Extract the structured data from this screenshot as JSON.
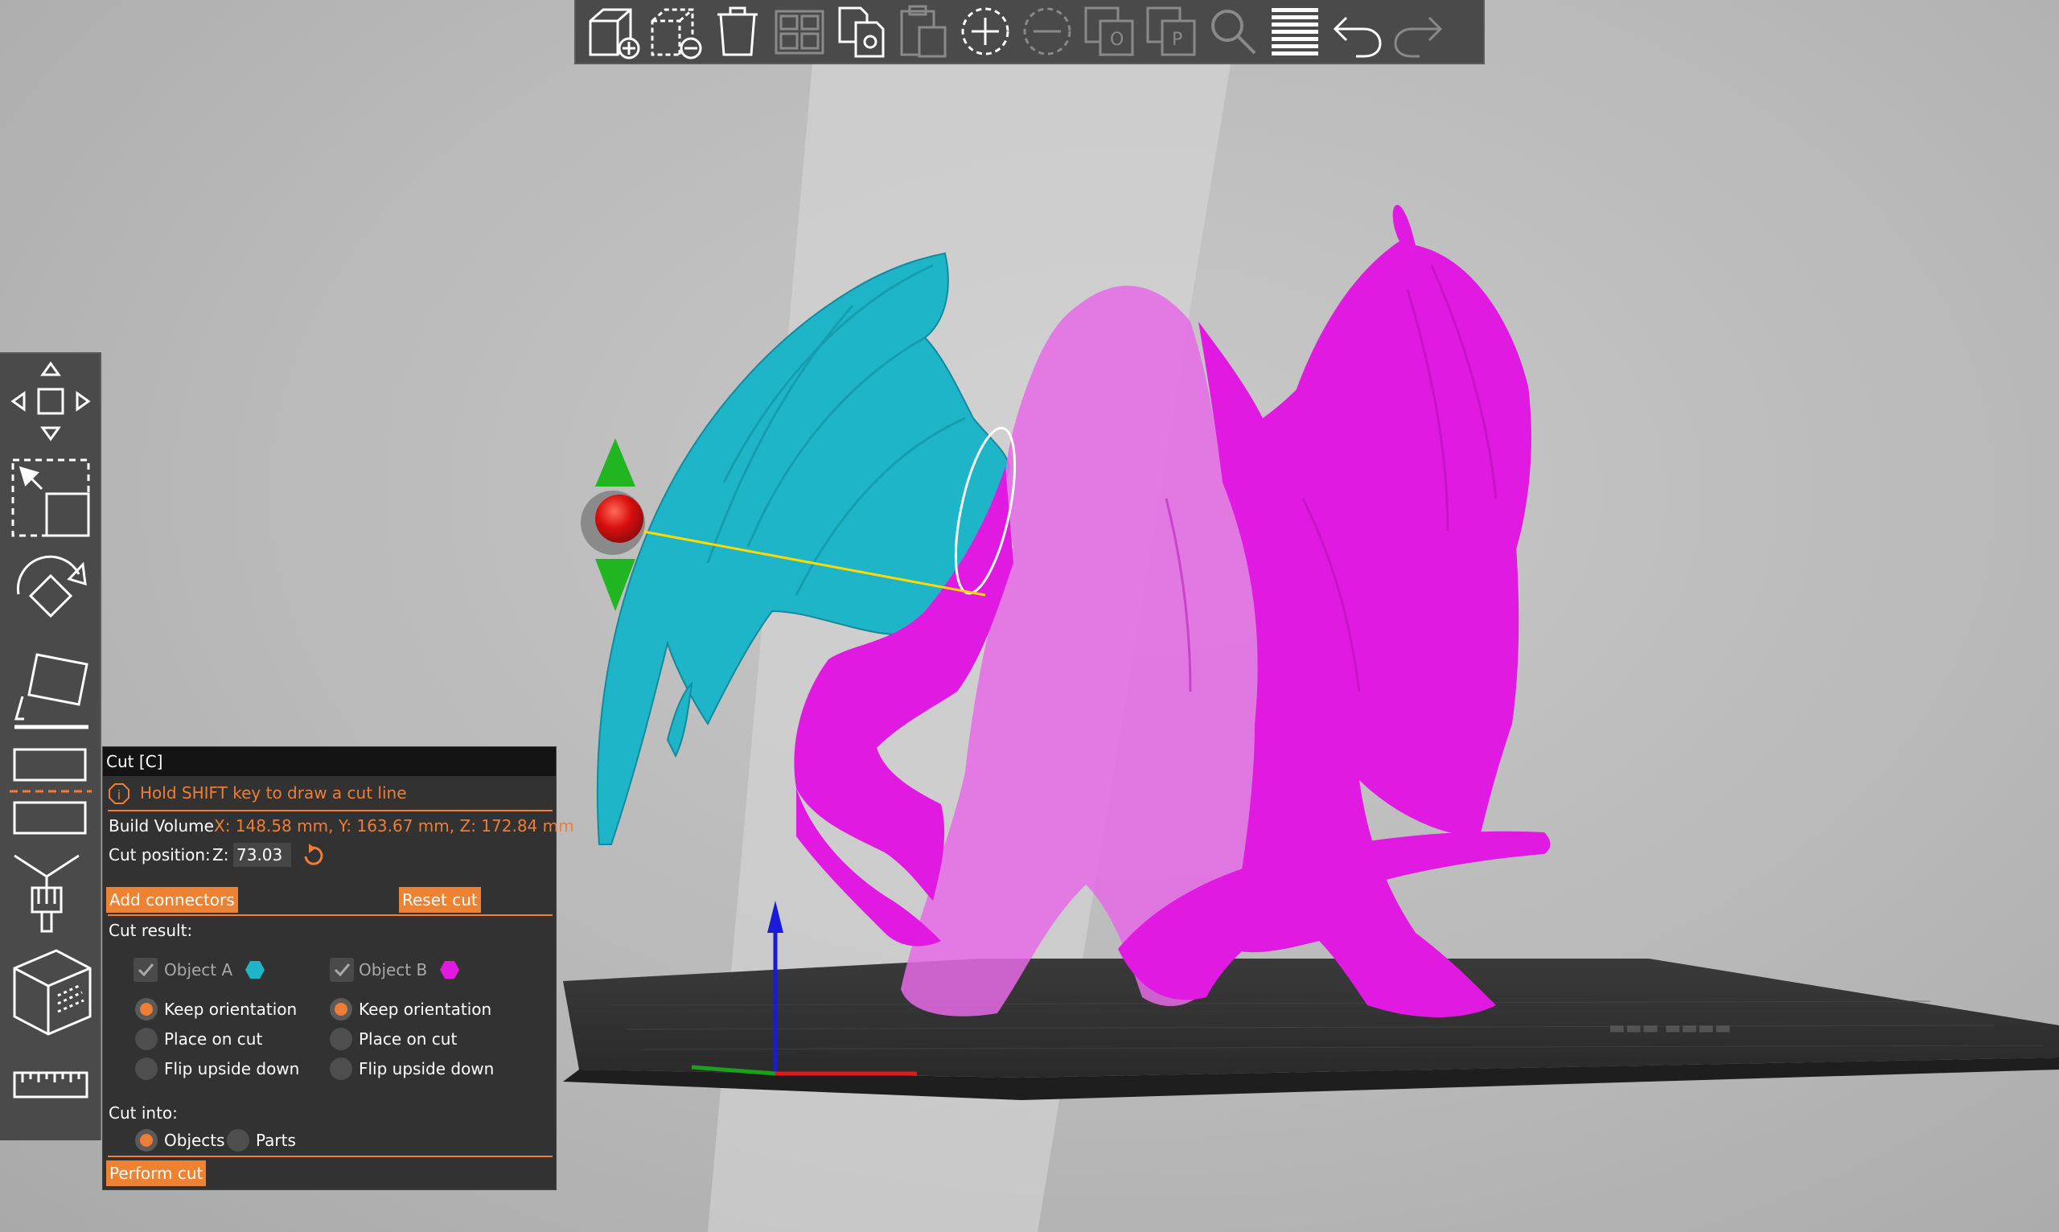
{
  "colors": {
    "accent": "#ef7d35",
    "object_a": "#1fb5c9",
    "object_b": "#e01ae0",
    "panel_bg": "#323232",
    "toolbar_bg": "#4a4a4a"
  },
  "top_toolbar": {
    "buttons": [
      {
        "icon": "add-object-icon",
        "enabled": true
      },
      {
        "icon": "remove-object-icon",
        "enabled": true
      },
      {
        "icon": "delete-all-icon",
        "enabled": true
      },
      {
        "icon": "arrange-icon",
        "enabled": false
      },
      {
        "icon": "copy-icon",
        "enabled": true
      },
      {
        "icon": "paste-icon",
        "enabled": false
      },
      {
        "icon": "add-instance-icon",
        "enabled": true
      },
      {
        "icon": "remove-instance-icon",
        "enabled": false
      },
      {
        "icon": "split-to-objects-icon",
        "enabled": false
      },
      {
        "icon": "split-to-parts-icon",
        "enabled": false
      },
      {
        "icon": "search-icon",
        "enabled": false
      },
      {
        "icon": "layers-editing-icon",
        "enabled": true
      },
      {
        "icon": "undo-icon",
        "enabled": true
      },
      {
        "icon": "redo-icon",
        "enabled": false
      }
    ]
  },
  "left_toolbar": {
    "tools": [
      "move-icon",
      "scale-icon",
      "rotate-icon",
      "place-on-face-icon",
      "cut-icon",
      "paint-supports-icon",
      "seam-painting-icon",
      "measure-icon"
    ]
  },
  "cut_panel": {
    "title": "Cut [C]",
    "hint": "Hold SHIFT key to draw a cut line",
    "build_volume_label": "Build Volume",
    "build_volume_value": "X: 148.58 mm,  Y: 163.67 mm,  Z: 172.84 mm",
    "cut_position_label": "Cut position:",
    "z_label": "Z:",
    "z_value": "73.03",
    "add_connectors": "Add connectors",
    "reset_cut": "Reset cut",
    "cut_result_label": "Cut result:",
    "object_a": {
      "label": "Object A",
      "checked": true,
      "options": [
        "Keep orientation",
        "Place on cut",
        "Flip upside down"
      ],
      "selected": "Keep orientation"
    },
    "object_b": {
      "label": "Object B",
      "checked": true,
      "options": [
        "Keep orientation",
        "Place on cut",
        "Flip upside down"
      ],
      "selected": "Keep orientation"
    },
    "cut_into_label": "Cut into:",
    "cut_into_options": [
      "Objects",
      "Parts"
    ],
    "cut_into_selected": "Objects",
    "perform_cut": "Perform cut"
  }
}
